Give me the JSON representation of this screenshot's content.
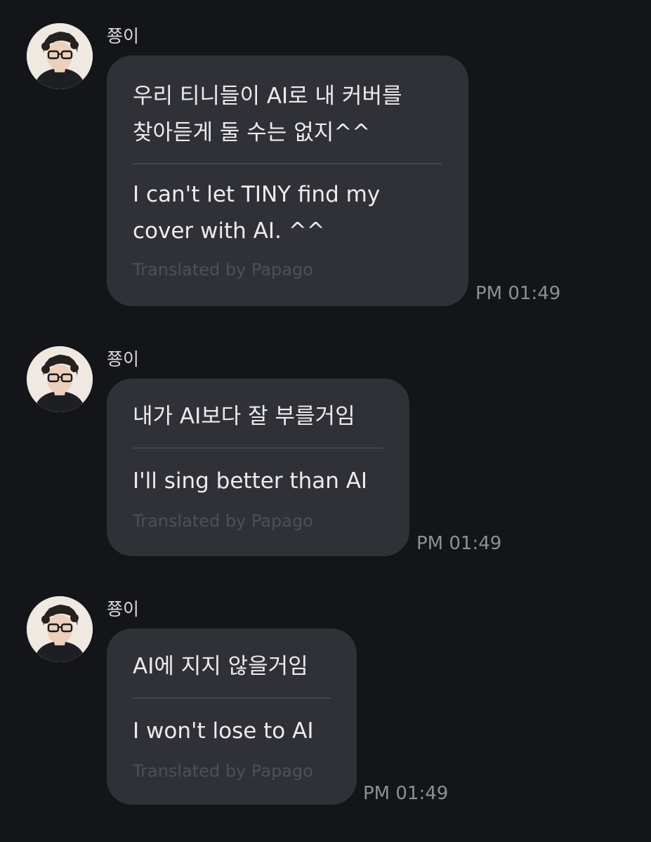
{
  "messages": [
    {
      "sender": "쭁이",
      "original_lines": [
        "우리 티니들이 AI로 내 커버를",
        "찾아듣게 둘 수는 없지^^"
      ],
      "translation_lines": [
        "I can't let TINY find my",
        "cover with AI. ^^"
      ],
      "translated_by": "Translated by Papago",
      "time": "PM 01:49"
    },
    {
      "sender": "쭁이",
      "original_lines": [
        "내가 AI보다 잘 부를거임"
      ],
      "translation_lines": [
        "I'll sing better than AI"
      ],
      "translated_by": "Translated by Papago",
      "time": "PM 01:49"
    },
    {
      "sender": "쭁이",
      "original_lines": [
        "AI에 지지 않을거임"
      ],
      "translation_lines": [
        "I won't lose to AI"
      ],
      "translated_by": "Translated by Papago",
      "time": "PM 01:49"
    }
  ]
}
